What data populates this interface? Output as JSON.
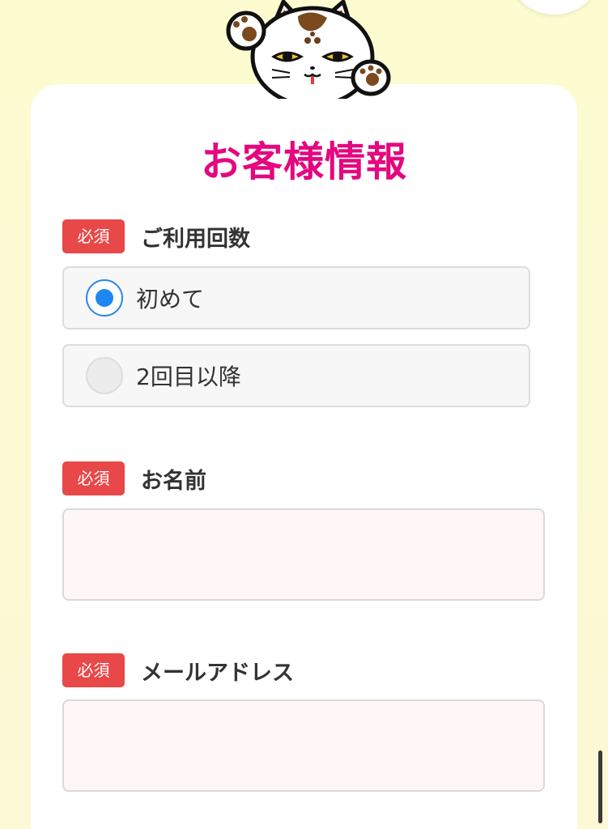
{
  "form": {
    "title": "お客様情報",
    "required_badge": "必須",
    "visit_count": {
      "label": "ご利用回数",
      "options": [
        {
          "label": "初めて",
          "checked": true
        },
        {
          "label": "2回目以降",
          "checked": false
        }
      ]
    },
    "name": {
      "label": "お名前",
      "value": "",
      "placeholder": ""
    },
    "email": {
      "label": "メールアドレス",
      "value": "",
      "placeholder": ""
    }
  },
  "colors": {
    "background": "#fcfad2",
    "title": "#e4077f",
    "required_badge": "#e84848",
    "radio_selected": "#1e88f0",
    "input_background": "#fff7f5"
  },
  "icons": {
    "mascot": "maneki-neko-cat-icon"
  }
}
